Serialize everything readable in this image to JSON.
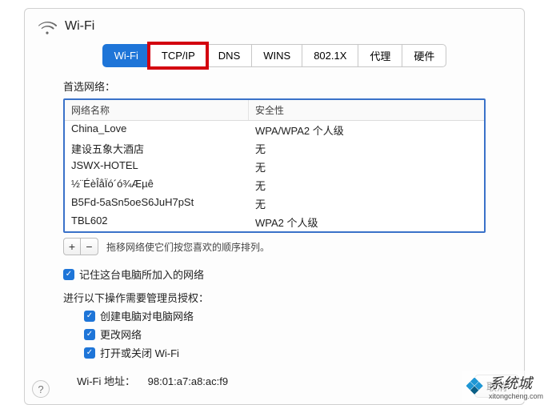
{
  "header": {
    "title": "Wi-Fi"
  },
  "tabs": {
    "items": [
      {
        "label": "Wi-Fi",
        "name": "tab-wifi",
        "active": true
      },
      {
        "label": "TCP/IP",
        "name": "tab-tcpip",
        "highlight": true
      },
      {
        "label": "DNS",
        "name": "tab-dns"
      },
      {
        "label": "WINS",
        "name": "tab-wins"
      },
      {
        "label": "802.1X",
        "name": "tab-8021x"
      },
      {
        "label": "代理",
        "name": "tab-proxy"
      },
      {
        "label": "硬件",
        "name": "tab-hardware"
      }
    ]
  },
  "networks": {
    "label": "首选网络：",
    "columns": {
      "name": "网络名称",
      "security": "安全性"
    },
    "rows": [
      {
        "name": "China_Love",
        "security": "WPA/WPA2 个人级"
      },
      {
        "name": "建设五象大酒店",
        "security": "无"
      },
      {
        "name": "JSWX-HOTEL",
        "security": "无"
      },
      {
        "name": "½¨ÉèÎåÏó´ó¾Æµê",
        "security": "无"
      },
      {
        "name": "B5Fd-5aSn5oeS6JuH7pSt",
        "security": "无"
      },
      {
        "name": "TBL602",
        "security": "WPA2 个人级"
      }
    ],
    "add": "+",
    "remove": "−",
    "hint": "拖移网络使它们按您喜欢的顺序排列。"
  },
  "remember": {
    "label": "记住这台电脑所加入的网络"
  },
  "admin": {
    "label": "进行以下操作需要管理员授权：",
    "items": [
      "创建电脑对电脑网络",
      "更改网络",
      "打开或关闭 Wi-Fi"
    ]
  },
  "mac": {
    "label": "Wi-Fi 地址：",
    "value": "98:01:a7:a8:ac:f9"
  },
  "help": "?",
  "cancel": "取消",
  "watermark": {
    "text": "系统城",
    "sub": "xitongcheng.com"
  }
}
